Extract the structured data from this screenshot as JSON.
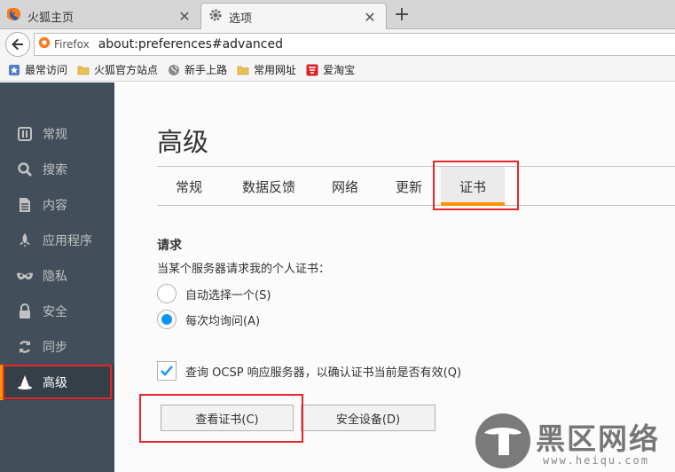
{
  "browser": {
    "tabs": [
      {
        "title": "火狐主页",
        "icon": "firefox-icon",
        "active": false
      },
      {
        "title": "选项",
        "icon": "gear-icon",
        "active": true
      }
    ],
    "new_tab": "+",
    "identity_label": "Firefox",
    "url": "about:preferences#advanced"
  },
  "bookmarks": [
    {
      "label": "最常访问",
      "icon": "bookmark-star-icon"
    },
    {
      "label": "火狐官方站点",
      "icon": "folder-icon"
    },
    {
      "label": "新手上路",
      "icon": "globe-icon"
    },
    {
      "label": "常用网址",
      "icon": "folder-icon"
    },
    {
      "label": "爱淘宝",
      "icon": "taobao-icon"
    }
  ],
  "sidebar": {
    "categories": [
      {
        "label": "常规",
        "icon": "general-icon"
      },
      {
        "label": "搜索",
        "icon": "search-icon"
      },
      {
        "label": "内容",
        "icon": "content-icon"
      },
      {
        "label": "应用程序",
        "icon": "rocket-icon"
      },
      {
        "label": "隐私",
        "icon": "mask-icon"
      },
      {
        "label": "安全",
        "icon": "lock-icon"
      },
      {
        "label": "同步",
        "icon": "sync-icon"
      },
      {
        "label": "高级",
        "icon": "wizard-hat-icon",
        "selected": true
      }
    ]
  },
  "page": {
    "title": "高级",
    "tabs": [
      {
        "label": "常规"
      },
      {
        "label": "数据反馈"
      },
      {
        "label": "网络"
      },
      {
        "label": "更新"
      },
      {
        "label": "证书",
        "selected": true
      }
    ],
    "requests": {
      "title": "请求",
      "description": "当某个服务器请求我的个人证书：",
      "options": [
        {
          "label": "自动选择一个(S)",
          "checked": false
        },
        {
          "label": "每次均询问(A)",
          "checked": true
        }
      ]
    },
    "ocsp": {
      "label": "查询 OCSP 响应服务器，以确认证书当前是否有效(Q)",
      "checked": true
    },
    "buttons": {
      "view_certificates": "查看证书(C)",
      "security_devices": "安全设备(D)"
    }
  },
  "watermark": {
    "text": "黑区网络",
    "sub": "www.heiqu.com"
  },
  "colors": {
    "accent": "#ff9500",
    "sidebar_bg": "#424f5a",
    "radio_blue": "#0996f8",
    "annotation_red": "#e5262b"
  }
}
